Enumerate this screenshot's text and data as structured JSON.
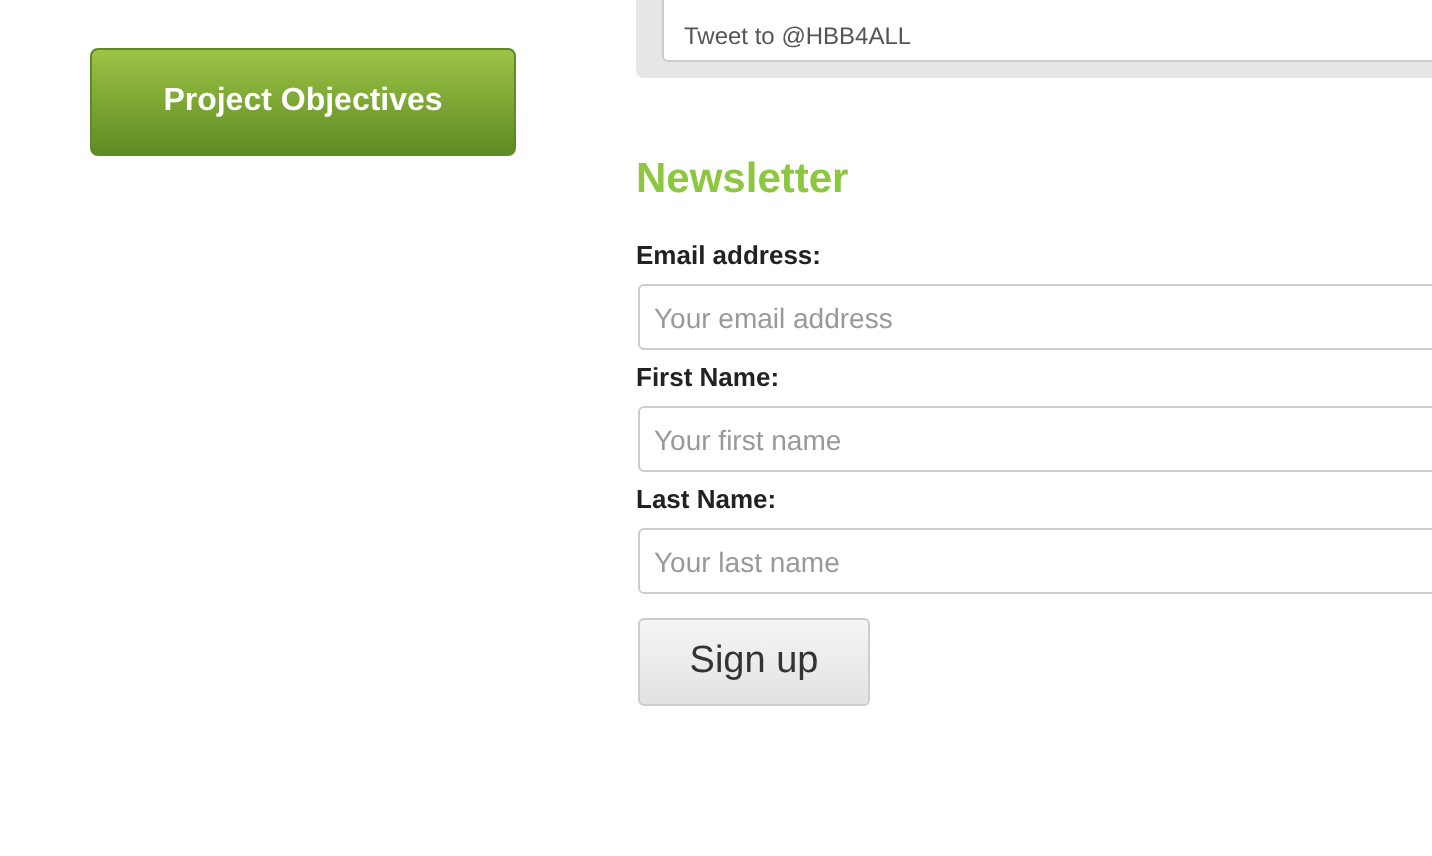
{
  "sidebar": {
    "button": "Project Objectives"
  },
  "tweet": {
    "placeholder": "Tweet to @HBB4ALL"
  },
  "newsletter": {
    "title": "Newsletter",
    "fields": [
      {
        "label": "Email address:",
        "placeholder": "Your email address"
      },
      {
        "label": "First Name:",
        "placeholder": "Your first name"
      },
      {
        "label": "Last Name:",
        "placeholder": "Your last name"
      }
    ],
    "submit": "Sign up"
  }
}
